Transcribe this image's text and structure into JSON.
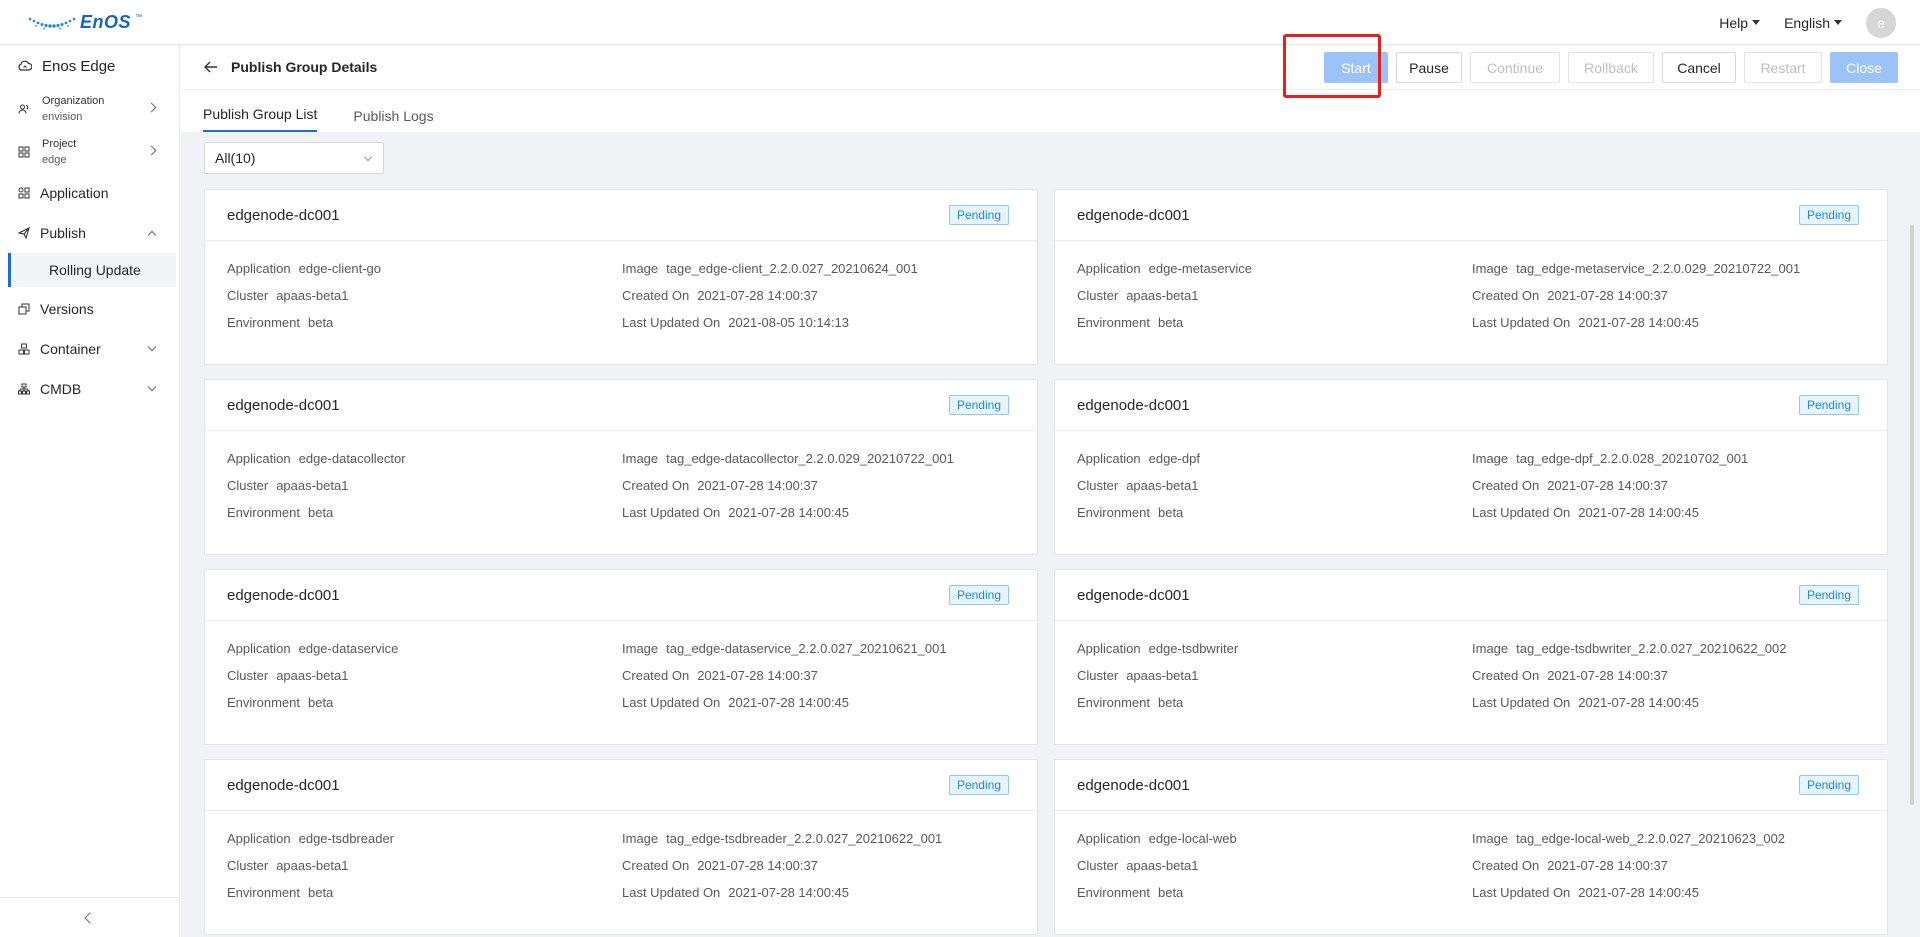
{
  "topbar": {
    "logo_text": "EnOS",
    "logo_tm": "™",
    "help_label": "Help",
    "language_label": "English",
    "avatar_letter": "e"
  },
  "sidebar": {
    "app_title": "Enos Edge",
    "organization": {
      "label": "Organization",
      "value": "envision"
    },
    "project": {
      "label": "Project",
      "value": "edge"
    },
    "items": {
      "application": "Application",
      "publish": "Publish",
      "rolling_update": "Rolling Update",
      "versions": "Versions",
      "container": "Container",
      "cmdb": "CMDB"
    }
  },
  "header": {
    "title": "Publish Group Details",
    "buttons": {
      "start": "Start",
      "pause": "Pause",
      "continue": "Continue",
      "rollback": "Rollback",
      "cancel": "Cancel",
      "restart": "Restart",
      "close": "Close"
    }
  },
  "tabs": {
    "list": "Publish Group List",
    "logs": "Publish Logs"
  },
  "filter": {
    "value": "All(10)"
  },
  "field_labels": {
    "application": "Application",
    "cluster": "Cluster",
    "environment": "Environment",
    "image": "Image",
    "created_on": "Created On",
    "last_updated_on": "Last Updated On"
  },
  "cards": [
    {
      "title": "edgenode-dc001",
      "status": "Pending",
      "application": "edge-client-go",
      "cluster": "apaas-beta1",
      "environment": "beta",
      "image": "tage_edge-client_2.2.0.027_20210624_001",
      "created_on": "2021-07-28 14:00:37",
      "last_updated_on": "2021-08-05 10:14:13"
    },
    {
      "title": "edgenode-dc001",
      "status": "Pending",
      "application": "edge-metaservice",
      "cluster": "apaas-beta1",
      "environment": "beta",
      "image": "tag_edge-metaservice_2.2.0.029_20210722_001",
      "created_on": "2021-07-28 14:00:37",
      "last_updated_on": "2021-07-28 14:00:45"
    },
    {
      "title": "edgenode-dc001",
      "status": "Pending",
      "application": "edge-datacollector",
      "cluster": "apaas-beta1",
      "environment": "beta",
      "image": "tag_edge-datacollector_2.2.0.029_20210722_001",
      "created_on": "2021-07-28 14:00:37",
      "last_updated_on": "2021-07-28 14:00:45"
    },
    {
      "title": "edgenode-dc001",
      "status": "Pending",
      "application": "edge-dpf",
      "cluster": "apaas-beta1",
      "environment": "beta",
      "image": "tag_edge-dpf_2.2.0.028_20210702_001",
      "created_on": "2021-07-28 14:00:37",
      "last_updated_on": "2021-07-28 14:00:45"
    },
    {
      "title": "edgenode-dc001",
      "status": "Pending",
      "application": "edge-dataservice",
      "cluster": "apaas-beta1",
      "environment": "beta",
      "image": "tag_edge-dataservice_2.2.0.027_20210621_001",
      "created_on": "2021-07-28 14:00:37",
      "last_updated_on": "2021-07-28 14:00:45"
    },
    {
      "title": "edgenode-dc001",
      "status": "Pending",
      "application": "edge-tsdbwriter",
      "cluster": "apaas-beta1",
      "environment": "beta",
      "image": "tag_edge-tsdbwriter_2.2.0.027_20210622_002",
      "created_on": "2021-07-28 14:00:37",
      "last_updated_on": "2021-07-28 14:00:45"
    },
    {
      "title": "edgenode-dc001",
      "status": "Pending",
      "application": "edge-tsdbreader",
      "cluster": "apaas-beta1",
      "environment": "beta",
      "image": "tag_edge-tsdbreader_2.2.0.027_20210622_001",
      "created_on": "2021-07-28 14:00:37",
      "last_updated_on": "2021-07-28 14:00:45"
    },
    {
      "title": "edgenode-dc001",
      "status": "Pending",
      "application": "edge-local-web",
      "cluster": "apaas-beta1",
      "environment": "beta",
      "image": "tag_edge-local-web_2.2.0.027_20210623_002",
      "created_on": "2021-07-28 14:00:37",
      "last_updated_on": "2021-07-28 14:00:45"
    }
  ],
  "colors": {
    "accent": "#1f6bd6",
    "primary_disabled": "#9cc3f7",
    "highlight": "#e52020",
    "pending_text": "#1f8ae0",
    "pending_bg": "#e8f4fd"
  }
}
